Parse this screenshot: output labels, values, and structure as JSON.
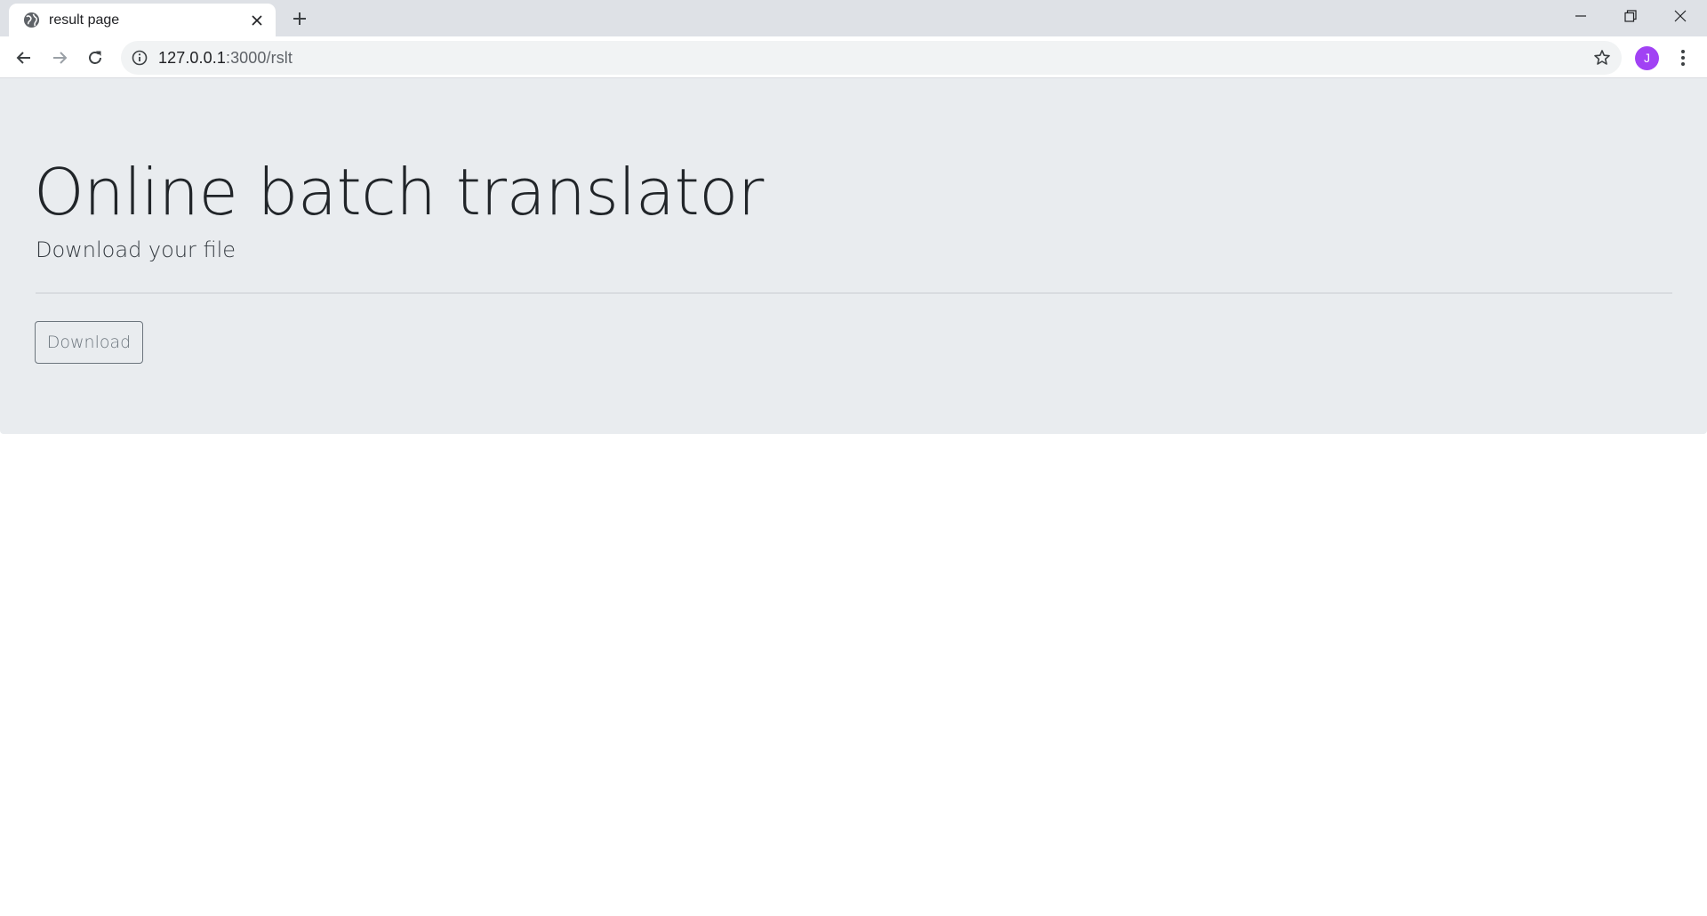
{
  "browser": {
    "tab": {
      "title": "result page",
      "favicon_icon": "globe-icon"
    },
    "address_bar": {
      "host": "127.0.0.1",
      "path": ":3000/rslt"
    },
    "profile_initial": "J",
    "colors": {
      "tabstrip": "#dee1e6",
      "omnibox": "#f1f3f4",
      "avatar": "#a142f4"
    }
  },
  "page": {
    "title": "Online batch translator",
    "subtitle": "Download your file",
    "download_button_label": "Download",
    "colors": {
      "jumbotron_bg": "#e9ecef",
      "button_outline": "#6c757d"
    }
  }
}
